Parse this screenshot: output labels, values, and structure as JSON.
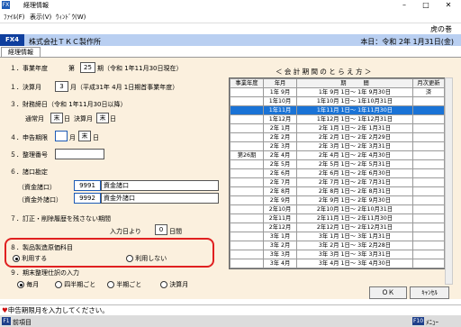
{
  "window": {
    "title": "経理情報"
  },
  "menu": [
    "ﾌｧｲﾙ(F)",
    "表示(V)",
    "ｳｨﾝﾄﾞｳ(W)"
  ],
  "header": {
    "book": "虎の巻",
    "fx_label": "FX4",
    "company": "株式会社ＴＫＣ製作所",
    "today": "本日：令和 2年 1月31日(金)"
  },
  "tab": "経理情報",
  "form": {
    "s1": "１．事業年度",
    "s1_pre": "第",
    "s1_val": "25",
    "s1_post": "期（令和 1年11月30日現在）",
    "s2": "１．決算月",
    "s2_val": "3",
    "s2_post": "月（平成31年 4月 1日期首事業年度）",
    "s3": "３．財務締日（令和 1年11月30日以降）",
    "s3a": "通常月",
    "s3a_val": "末",
    "s3a_unit": "日",
    "s3b": "決算月",
    "s3b_val": "末",
    "s3b_unit": "日",
    "s4": "４．申告期限",
    "s4_v1": "",
    "s4_u1": "月",
    "s4_v2": "末",
    "s4_u2": "日",
    "s5": "５．整理番号",
    "s5_val": "",
    "s6": "６．諸口勘定",
    "s6a": "（資金諸口）",
    "s6a_code": "9991",
    "s6a_name": "資金諸口",
    "s6b": "（資金外諸口）",
    "s6b_code": "9992",
    "s6b_name": "資金外諸口",
    "s7": "７．訂正・削除履歴を残さない期間",
    "s7a": "入力日より",
    "s7a_val": "0",
    "s7a_unit": "日間",
    "s8": "８．製品製造原価科目",
    "s8_opt1": "利用する",
    "s8_opt2": "利用しない",
    "s9": "９．期末整理仕訳の入力",
    "s9_opts": [
      "毎月",
      "四半期ごと",
      "半期ごと",
      "決算月"
    ]
  },
  "grid": {
    "title": "＜ 会 計 期 間 の と ら え 方 ＞",
    "headers": [
      "事業年度",
      "年月",
      "期　　　間",
      "月次更新"
    ],
    "rows": [
      [
        "",
        "1年 9月",
        "1年 9月 1日～ 1年 9月30日",
        "済"
      ],
      [
        "",
        "1年10月",
        "1年10月 1日～ 1年10月31日",
        ""
      ],
      [
        "",
        "1年11月",
        "1年11月 1日～ 1年11月30日",
        ""
      ],
      [
        "",
        "1年12月",
        "1年12月 1日～ 1年12月31日",
        ""
      ],
      [
        "",
        "2年 1月",
        "2年 1月 1日～ 2年 1月31日",
        ""
      ],
      [
        "",
        "2年 2月",
        "2年 2月 1日～ 2年 2月29日",
        ""
      ],
      [
        "",
        "2年 3月",
        "2年 3月 1日～ 2年 3月31日",
        ""
      ],
      [
        "第26期",
        "2年 4月",
        "2年 4月 1日～ 2年 4月30日",
        ""
      ],
      [
        "",
        "2年 5月",
        "2年 5月 1日～ 2年 5月31日",
        ""
      ],
      [
        "",
        "2年 6月",
        "2年 6月 1日～ 2年 6月30日",
        ""
      ],
      [
        "",
        "2年 7月",
        "2年 7月 1日～ 2年 7月31日",
        ""
      ],
      [
        "",
        "2年 8月",
        "2年 8月 1日～ 2年 8月31日",
        ""
      ],
      [
        "",
        "2年 9月",
        "2年 9月 1日～ 2年 9月30日",
        ""
      ],
      [
        "",
        "2年10月",
        "2年10月 1日～ 2年10月31日",
        ""
      ],
      [
        "",
        "2年11月",
        "2年11月 1日～ 2年11月30日",
        ""
      ],
      [
        "",
        "2年12月",
        "2年12月 1日～ 2年12月31日",
        ""
      ],
      [
        "",
        "3年 1月",
        "3年 1月 1日～ 3年 1月31日",
        ""
      ],
      [
        "",
        "3年 2月",
        "3年 2月 1日～ 3年 2月28日",
        ""
      ],
      [
        "",
        "3年 3月",
        "3年 3月 1日～ 3年 3月31日",
        ""
      ],
      [
        "",
        "3年 4月",
        "3年 4月 1日～ 3年 4月30日",
        ""
      ]
    ],
    "selected_row": 2
  },
  "buttons": {
    "ok": "ＯＫ",
    "cancel": "ｷｬﾝｾﾙ"
  },
  "status": "申告期限月を入力してください。",
  "footer": {
    "f1_key": "F1",
    "f1_label": "前項目",
    "f10_key": "F10",
    "f10_label": "ﾒﾆｭｰ"
  }
}
